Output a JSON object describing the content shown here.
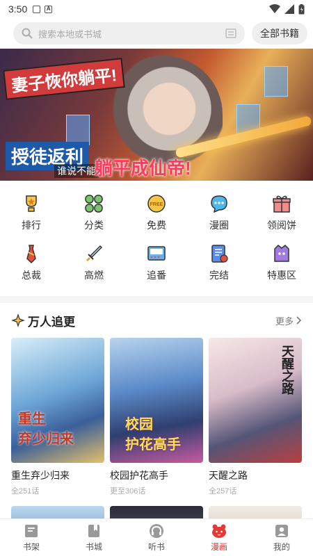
{
  "status": {
    "time": "3:50"
  },
  "search": {
    "placeholder": "搜索本地或书城",
    "all_books": "全部书籍"
  },
  "banner": {
    "title_top": "妻子恢你躺平!",
    "title_main": "授徒返利",
    "subtitle": "谁说不能",
    "title_tail": "躺平成仙帝!"
  },
  "categories": [
    {
      "label": "排行",
      "icon": "trophy-icon"
    },
    {
      "label": "分类",
      "icon": "leaf-grid-icon"
    },
    {
      "label": "免费",
      "icon": "free-badge-icon"
    },
    {
      "label": "漫圈",
      "icon": "chat-bubble-icon"
    },
    {
      "label": "领阅饼",
      "icon": "gift-icon"
    },
    {
      "label": "总裁",
      "icon": "tie-icon"
    },
    {
      "label": "高燃",
      "icon": "sword-icon"
    },
    {
      "label": "追番",
      "icon": "tv-icon"
    },
    {
      "label": "完结",
      "icon": "finished-doc-icon"
    },
    {
      "label": "特惠区",
      "icon": "discount-icon"
    }
  ],
  "section": {
    "title": "万人追更",
    "more": "更多"
  },
  "books": [
    {
      "name": "重生弃少归来",
      "sub": "全251话",
      "cover_text": "重生\n弃少归来",
      "colors": [
        "#c9e6f5",
        "#5a8fc0",
        "#e6c06a"
      ]
    },
    {
      "name": "校园护花高手",
      "sub": "更至306话",
      "cover_text": "校园\n护花高手",
      "colors": [
        "#a7c7e8",
        "#3e6fb5",
        "#c85aa0"
      ]
    },
    {
      "name": "天醒之路",
      "sub": "全257话",
      "cover_text": "天醒之路",
      "colors": [
        "#f3dede",
        "#bfa0b5",
        "#d04040"
      ]
    }
  ],
  "tabs": [
    {
      "label": "书架",
      "icon": "bookshelf-icon",
      "active": false
    },
    {
      "label": "书城",
      "icon": "bookstore-icon",
      "active": false
    },
    {
      "label": "听书",
      "icon": "headphones-icon",
      "active": false
    },
    {
      "label": "漫画",
      "icon": "comic-bear-icon",
      "active": true
    },
    {
      "label": "我的",
      "icon": "profile-icon",
      "active": false
    }
  ],
  "colors": {
    "accent": "#e53935",
    "bg": "#f5f5f5"
  }
}
